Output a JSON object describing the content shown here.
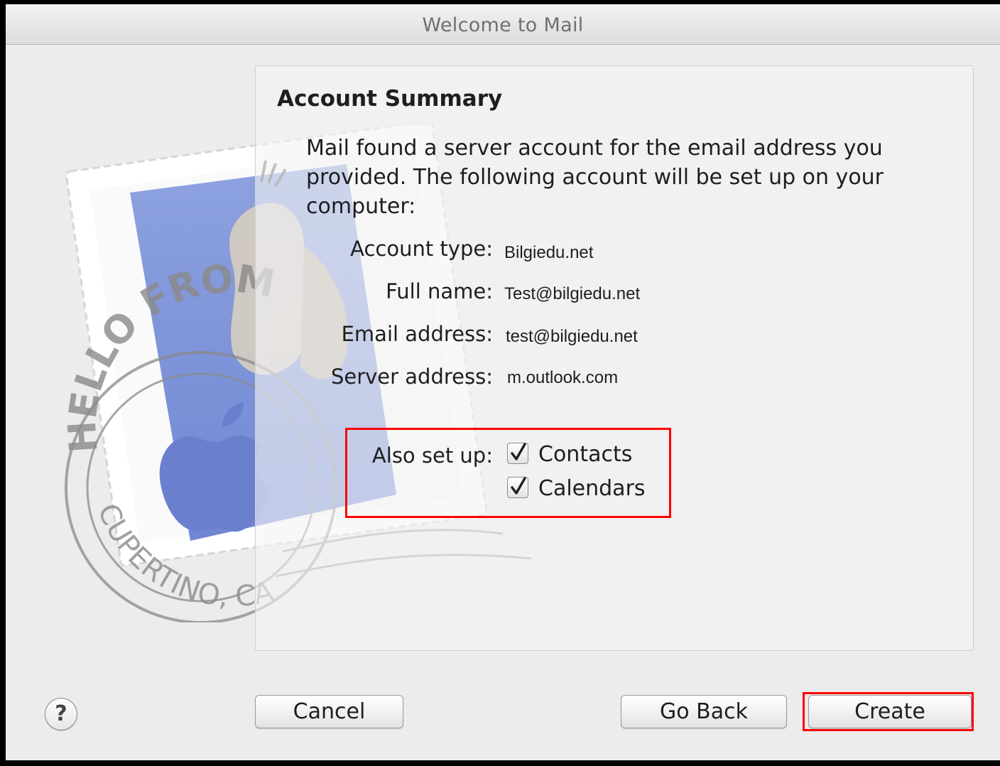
{
  "window": {
    "title": "Welcome to Mail"
  },
  "stamp": {
    "postmark_top": "HELLO FROM",
    "postmark_bottom": "CUPERTINO, CA"
  },
  "summary": {
    "heading": "Account Summary",
    "intro_lines": [
      "Mail found a server account for the email address you",
      "provided.  The following account will be set up on your",
      "computer:"
    ],
    "rows": [
      {
        "label": "Account type:",
        "value": "Bilgiedu.net"
      },
      {
        "label": "Full name:",
        "value": "Test@bilgiedu.net"
      },
      {
        "label": "Email address:",
        "value": "test@bilgiedu.net"
      },
      {
        "label": "Server address:",
        "value": "m.outlook.com"
      }
    ],
    "also_setup": {
      "label": "Also set up:",
      "options": [
        {
          "label": "Contacts",
          "checked": true
        },
        {
          "label": "Calendars",
          "checked": true
        }
      ]
    }
  },
  "buttons": {
    "help_label": "?",
    "cancel_label": "Cancel",
    "go_back_label": "Go Back",
    "create_label": "Create"
  },
  "colors": {
    "highlight": "#ff0000",
    "stamp_blue": "#7f95d8"
  }
}
